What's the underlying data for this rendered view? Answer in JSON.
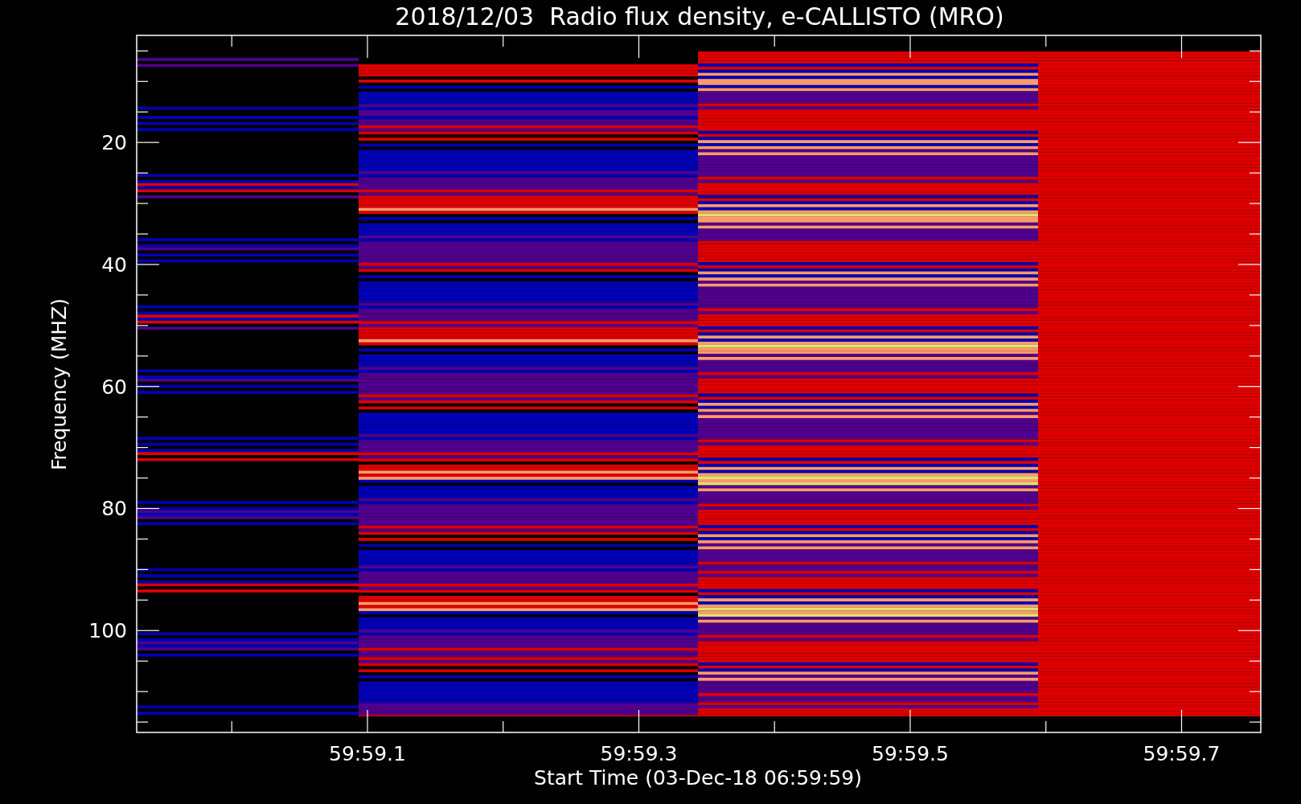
{
  "title": "2018/12/03  Radio flux density, e-CALLISTO (MRO)",
  "spectrogram": {
    "xlabel": "Start Time (03-Dec-18 06:59:59)",
    "ylabel": "Frequency (MHZ)",
    "xticks": [
      "59:59.1",
      "59:59.3",
      "59:59.5",
      "59:59.7"
    ],
    "yticks": [
      "20",
      "40",
      "60",
      "80",
      "100"
    ]
  }
}
